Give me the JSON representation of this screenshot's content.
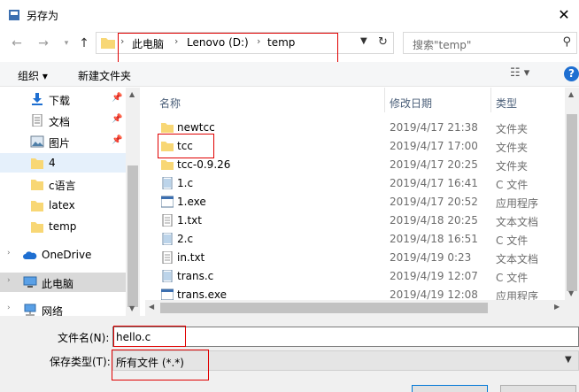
{
  "window": {
    "title": "另存为"
  },
  "nav": {
    "breadcrumbs": [
      "此电脑",
      "Lenovo (D:)",
      "temp"
    ],
    "search_placeholder": "搜索\"temp\""
  },
  "toolbar": {
    "organize": "组织 ▾",
    "new_folder": "新建文件夹"
  },
  "sidebar": {
    "items": [
      {
        "label": "下载",
        "icon": "download-icon"
      },
      {
        "label": "文档",
        "icon": "document-icon"
      },
      {
        "label": "图片",
        "icon": "picture-icon"
      },
      {
        "label": "4",
        "icon": "folder-icon"
      },
      {
        "label": "c语言",
        "icon": "folder-icon"
      },
      {
        "label": "latex",
        "icon": "folder-icon"
      },
      {
        "label": "temp",
        "icon": "folder-icon"
      },
      {
        "label": "OneDrive",
        "icon": "cloud-icon"
      },
      {
        "label": "此电脑",
        "icon": "computer-icon"
      },
      {
        "label": "网络",
        "icon": "network-icon"
      }
    ]
  },
  "file_list": {
    "columns": [
      "名称",
      "修改日期",
      "类型"
    ],
    "rows": [
      {
        "name": "newtcc",
        "date": "2019/4/17 21:38",
        "type": "文件夹",
        "icon": "folder-icon"
      },
      {
        "name": "tcc",
        "date": "2019/4/17 17:00",
        "type": "文件夹",
        "icon": "folder-icon"
      },
      {
        "name": "tcc-0.9.26",
        "date": "2019/4/17 20:25",
        "type": "文件夹",
        "icon": "folder-icon"
      },
      {
        "name": "1.c",
        "date": "2019/4/17 16:41",
        "type": "C 文件",
        "icon": "c-file-icon"
      },
      {
        "name": "1.exe",
        "date": "2019/4/17 20:52",
        "type": "应用程序",
        "icon": "exe-icon"
      },
      {
        "name": "1.txt",
        "date": "2019/4/18 20:25",
        "type": "文本文档",
        "icon": "text-file-icon"
      },
      {
        "name": "2.c",
        "date": "2019/4/18 16:51",
        "type": "C 文件",
        "icon": "c-file-icon"
      },
      {
        "name": "in.txt",
        "date": "2019/4/19 0:23",
        "type": "文本文档",
        "icon": "text-file-icon"
      },
      {
        "name": "trans.c",
        "date": "2019/4/19 12:07",
        "type": "C 文件",
        "icon": "c-file-icon"
      },
      {
        "name": "trans.exe",
        "date": "2019/4/19 12:08",
        "type": "应用程序",
        "icon": "exe-icon"
      }
    ]
  },
  "form": {
    "filename_label": "文件名(N):",
    "filename_value": "hello.c",
    "filetype_label": "保存类型(T):",
    "filetype_value": "所有文件  (*.*)"
  },
  "colors": {
    "highlight": "#e00000",
    "folder": "#f8d775",
    "accent": "#0078d7"
  }
}
